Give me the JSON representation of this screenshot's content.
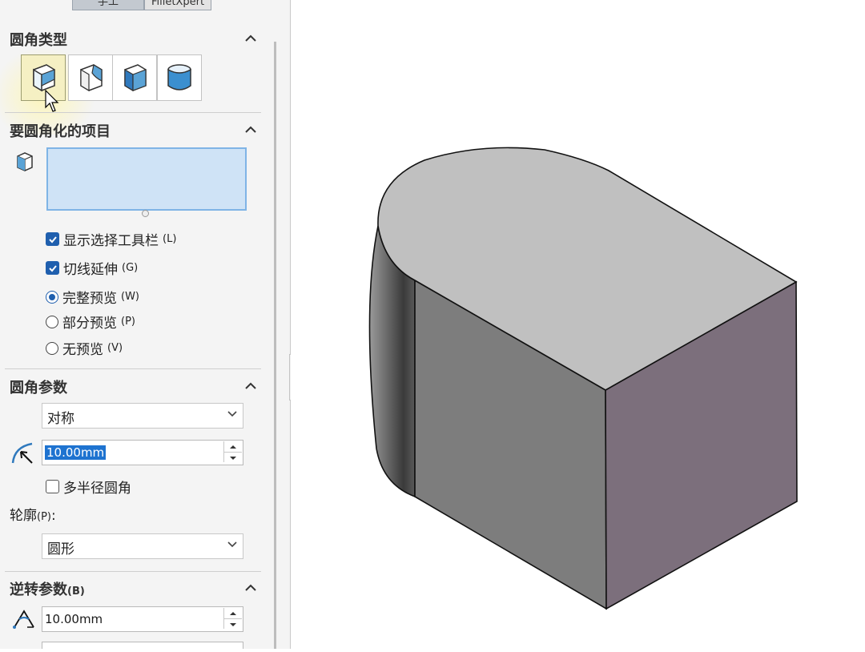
{
  "tabs": [
    {
      "label": "手工",
      "active": true
    },
    {
      "label": "FilletXpert",
      "active": false
    }
  ],
  "sections": {
    "fillet_type": {
      "title": "圆角类型"
    },
    "items": {
      "title": "要圆角化的项目"
    },
    "params": {
      "title": "圆角参数"
    },
    "setback": {
      "title_main": "逆转参数",
      "title_mnemonic": "(B)"
    }
  },
  "fillet_types": [
    {
      "name": "constant-size-fillet",
      "selected": true
    },
    {
      "name": "variable-size-fillet",
      "selected": false
    },
    {
      "name": "face-fillet",
      "selected": false
    },
    {
      "name": "full-round-fillet",
      "selected": false
    }
  ],
  "options": {
    "show_toolbar": {
      "label": "显示选择工具栏",
      "mnemonic": "(L)",
      "checked": true
    },
    "tangent_propagation": {
      "label": "切线延伸",
      "mnemonic": "(G)",
      "checked": true
    },
    "full_preview": {
      "label": "完整预览",
      "mnemonic": "(W)",
      "selected": true
    },
    "partial_preview": {
      "label": "部分预览",
      "mnemonic": "(P)",
      "selected": false
    },
    "no_preview": {
      "label": "无预览",
      "mnemonic": "(V)",
      "selected": false
    }
  },
  "params": {
    "method": "对称",
    "radius": "10.00mm",
    "multi_radius": {
      "label": "多半径圆角",
      "checked": false
    },
    "profile_label": "轮廓",
    "profile_mnemonic": "(P)",
    "profile_suffix": ":",
    "profile_value": "圆形"
  },
  "setback": {
    "distance": "10.00mm"
  },
  "colors": {
    "accent": "#1f5fae",
    "selection_fill": "#cfe3f6",
    "selection_border": "#7fb4e6",
    "model_top": "#c0c0c0",
    "model_front": "#7d7d7d",
    "model_right": "#7c6f7c"
  }
}
